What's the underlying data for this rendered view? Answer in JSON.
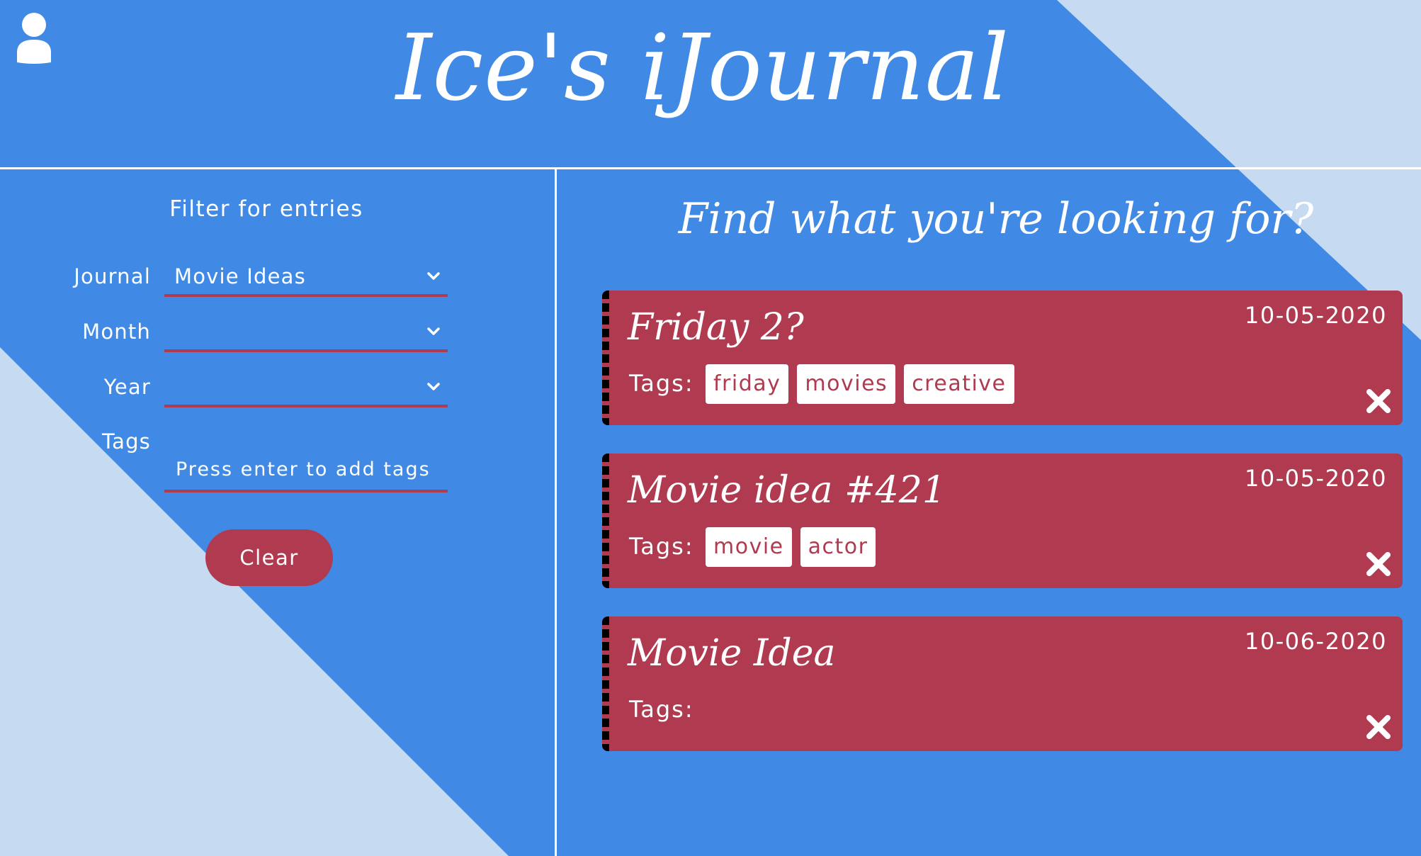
{
  "colors": {
    "background": "#408AE6",
    "triangle": "#C6DBF2",
    "accent": "#B03A4F",
    "text": "#FFFFFF"
  },
  "header": {
    "title": "Ice's iJournal",
    "user_icon": "user-icon"
  },
  "filter": {
    "title": "Filter for entries",
    "journal": {
      "label": "Journal",
      "value": "Movie Ideas"
    },
    "month": {
      "label": "Month",
      "value": ""
    },
    "year": {
      "label": "Year",
      "value": ""
    },
    "tags": {
      "label": "Tags",
      "placeholder": "Press enter to add tags"
    },
    "clear_label": "Clear"
  },
  "results": {
    "title": "Find what you're looking for?",
    "tags_label": "Tags:",
    "entries": [
      {
        "title": "Friday 2?",
        "date": "10-05-2020",
        "tags": [
          "friday",
          "movies",
          "creative"
        ]
      },
      {
        "title": "Movie idea #421",
        "date": "10-05-2020",
        "tags": [
          "movie",
          "actor"
        ]
      },
      {
        "title": "Movie Idea",
        "date": "10-06-2020",
        "tags": []
      }
    ]
  }
}
